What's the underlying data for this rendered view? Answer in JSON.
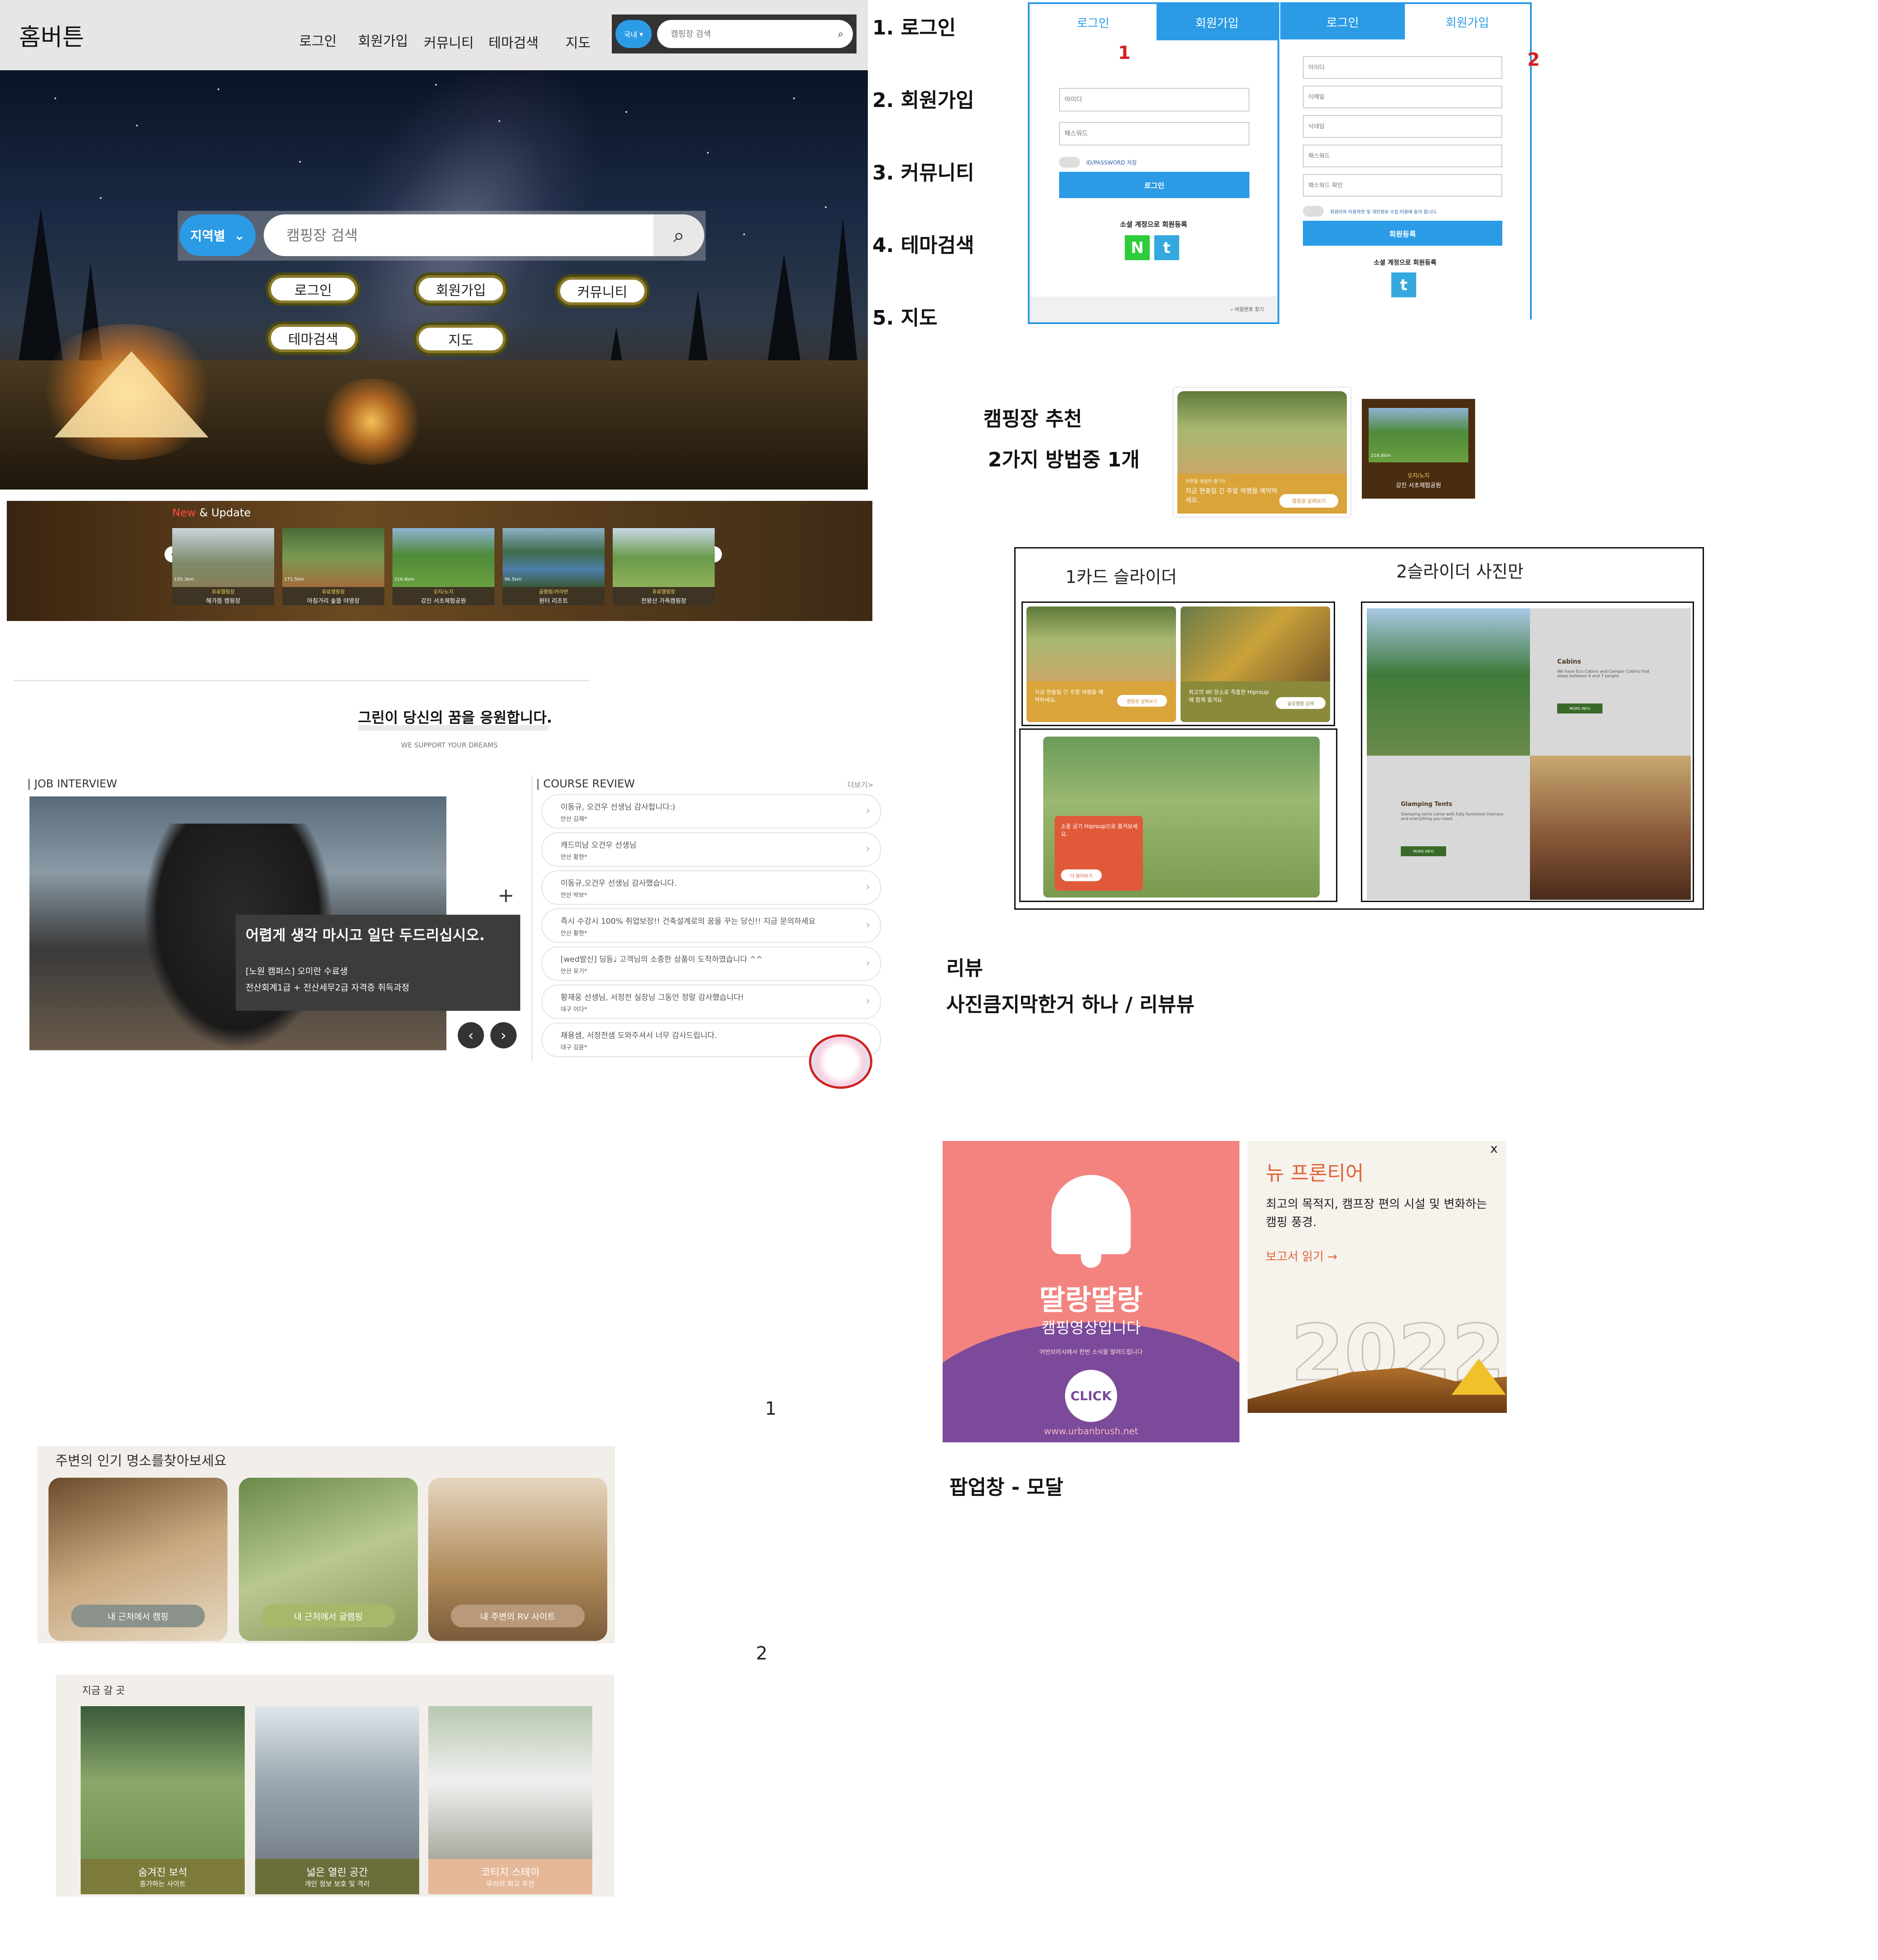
{
  "site": {
    "logo": "홈버튼"
  },
  "nav": {
    "items": [
      "로그인",
      "회원가입",
      "커뮤니티",
      "테마검색",
      "지도"
    ]
  },
  "header_search": {
    "region": "국내",
    "placeholder": "캠핑장 검색"
  },
  "hero": {
    "region_button": "지역별",
    "search_placeholder": "캠핑장 검색",
    "buttons": [
      "로그인",
      "회원가입",
      "커뮤니티",
      "테마검색",
      "지도"
    ]
  },
  "new_update": {
    "title_new": "New",
    "title_rest": " & Update",
    "cards": [
      {
        "tag": "유료캠핑장",
        "name": "해가뜸 캠핑장",
        "dist": "155.3km"
      },
      {
        "tag": "유료캠핑장",
        "name": "아침가리 숲뜰 야영장",
        "dist": "171.5km"
      },
      {
        "tag": "오지/노지",
        "name": "강진 서초체험공원",
        "dist": "216.8km"
      },
      {
        "tag": "글램핑/카라반",
        "name": "원터 리조트",
        "dist": "96.5km"
      },
      {
        "tag": "유료캠핑장",
        "name": "천왕산 가족캠핑장",
        "dist": ""
      }
    ]
  },
  "side_list": {
    "items": [
      "1. 로그인",
      "2. 회원가입",
      "3. 커뮤니티",
      "4. 테마검색",
      "5. 지도"
    ]
  },
  "login_forms": {
    "tab_login": "로그인",
    "tab_signup": "회원가입",
    "num1": "1",
    "num2": "2",
    "login": {
      "id_placeholder": "아이디",
      "pw_placeholder": "패스워드",
      "remember": "ID/PASSWORD 저장",
      "submit": "로그인",
      "social": "소셜 계정으로 회원등록",
      "footer": "비밀번호 찾기"
    },
    "signup": {
      "fields": [
        "아이디",
        "이메일",
        "닉네임",
        "패스워드",
        "패스워드 확인"
      ],
      "agree": "회원이자 이용약관 및 개인정보 수집·이용에 동의 합니다.",
      "submit": "회원등록",
      "social": "소셜 계정으로 회원등록"
    }
  },
  "recommend": {
    "caption1": "캠핑장 추천",
    "caption2": "2가지 방법중 1개",
    "card_a_text1": "자연을 벗삼아 즐기는",
    "card_a_text2": "지금 현충일 긴 주말 여행을 예약하세요.",
    "card_a_btn": "캠핑장 살펴보기",
    "card_b_dist": "216.8km",
    "card_b_tag": "오지/노지",
    "card_b_name": "강진 서초체험공원"
  },
  "slider_demo": {
    "label1": "1카드 슬라이더",
    "label2": "2슬라이더 사진만",
    "c1_text": "지금 현충일 긴 주말 여행을 예약하세요.",
    "c1_btn": "캠핑장 살펴보기",
    "c2_text": "최고의 Wi 장소로 즉흥한 Hiproup에 함께 즐겨요",
    "c2_btn": "솔로캠핑 검색",
    "c3_text": "소중 공기 Hiproup으로 즐겨보세요.",
    "c3_btn": "더 알아보기",
    "cabins_title": "Cabins",
    "cabins_body": "We have Eco Cabins and Camper Cabins that sleep between 4 and 7 people.",
    "glamping_title": "Glamping Tents",
    "glamping_body": "Glamping tents come with fully furnished interiors and everything you need.",
    "more": "MORE INFO"
  },
  "review_caption": {
    "line1": "리뷰",
    "line2": "사진큼지막한거 하나 / 리뷰뷰"
  },
  "support": {
    "title": "그린이 당신의 꿈을 응원합니다.",
    "subtitle": "WE SUPPORT YOUR DREAMS"
  },
  "job": {
    "heading": "| JOB INTERVIEW",
    "quote": "어렵게 생각 마시고 일단 두드리십시오.",
    "line1": "[노원 캠퍼스] 오미란 수료생",
    "line2": "전산회계1급 + 전산세무2급 자격증 취득과정",
    "plus": "+"
  },
  "course": {
    "heading": "| COURSE REVIEW",
    "more": "더보기>",
    "items": [
      {
        "title": "이동규, 오건우 선생님 감사합니다:)",
        "meta": "안산 김제*"
      },
      {
        "title": "캐드미남 오건우 선생님",
        "meta": "안산 황현*"
      },
      {
        "title": "이동규,오건우 선생님 감사했습니다.",
        "meta": "안산 박보*"
      },
      {
        "title": "즉시 수강시 100% 취업보장!! 건축설계로의 꿈을 꾸는 당신!! 지금 문의하세요",
        "meta": "안산 황현*"
      },
      {
        "title": "[wed발신] 딩동♩ 고객님의 소중한 상품이 도착하였습니다 ^^",
        "meta": "안산 유기*"
      },
      {
        "title": "황재웅 선생님, 서정전 실장님 그동안 정말 감사했습니다!",
        "meta": "대구 이다*"
      },
      {
        "title": "채용샘, 서정전샘 도와주셔서 너무 감사드립니다.",
        "meta": "대구 김윤*"
      }
    ]
  },
  "popup": {
    "ding": "딸랑딸랑",
    "sub": "캠핑영상입니다",
    "small": "어반브러시에서 한번 소식을 알려드립니다",
    "click": "CLICK",
    "url": "www.urbanbrush.net",
    "title": "뉴 프론티어",
    "body": "최고의 목적지, 캠프장 편의 시설 및 변화하는 캠핑 풍경.",
    "link": "보고서 읽기",
    "year": "2022",
    "close": "x",
    "caption": "팝업창 - 모달"
  },
  "markers": {
    "one": "1",
    "two": "2"
  },
  "nearby": {
    "title": "주변의 인기 명소를찾아보세요",
    "cards": [
      "내 근처에서 캠핑",
      "내 근처에서 글램핑",
      "내 주변의 RV 사이트"
    ]
  },
  "go": {
    "title": "지금 갈 곳",
    "cards": [
      {
        "name": "숨겨진 보석",
        "sub": "증가하는 사이트"
      },
      {
        "name": "넓은 열린 공간",
        "sub": "개인 정보 보호 및 격리"
      },
      {
        "name": "코티지 스테이",
        "sub": "우리의 최고 추천"
      }
    ]
  },
  "colors": {
    "accent_blue": "#2b9be6",
    "olive": "#7a7a3a",
    "popup_pink": "#f3837f",
    "popup_purple": "#7b4a9a",
    "frontier_orange": "#e0643a"
  }
}
